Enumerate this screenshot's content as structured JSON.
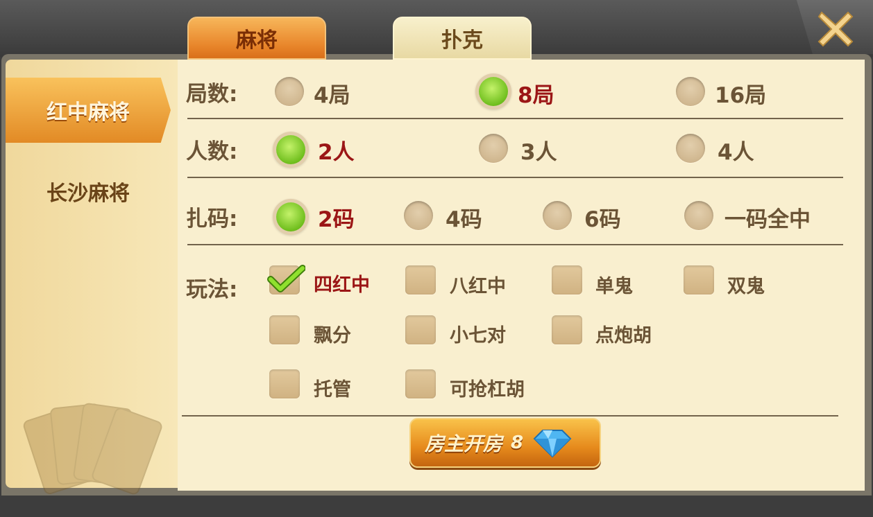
{
  "tabs": [
    {
      "label": "麻将",
      "active": true
    },
    {
      "label": "扑克",
      "active": false
    }
  ],
  "sidebar": {
    "items": [
      {
        "label": "红中麻将",
        "active": true
      },
      {
        "label": "长沙麻将",
        "active": false
      }
    ]
  },
  "rounds": {
    "label": "局数:",
    "options": [
      "4局",
      "8局",
      "16局"
    ],
    "selected": "8局"
  },
  "players": {
    "label": "人数:",
    "options": [
      "2人",
      "3人",
      "4人"
    ],
    "selected": "2人"
  },
  "zhama": {
    "label": "扎码:",
    "options": [
      "2码",
      "4码",
      "6码",
      "一码全中"
    ],
    "selected": "2码"
  },
  "rules": {
    "label": "玩法:",
    "options": [
      {
        "label": "四红中",
        "checked": true
      },
      {
        "label": "八红中",
        "checked": false
      },
      {
        "label": "单鬼",
        "checked": false
      },
      {
        "label": "双鬼",
        "checked": false
      },
      {
        "label": "飘分",
        "checked": false
      },
      {
        "label": "小七对",
        "checked": false
      },
      {
        "label": "点炮胡",
        "checked": false
      },
      {
        "label": "托管",
        "checked": false
      },
      {
        "label": "可抢杠胡",
        "checked": false
      }
    ]
  },
  "create_button": {
    "label": "房主开房",
    "cost": "8",
    "currency_icon": "diamond-icon"
  },
  "icons": {
    "close": "close-icon",
    "check": "checkmark-icon"
  },
  "colors": {
    "accent_orange": "#e8852a",
    "selected_text": "#9b1616",
    "radio_on": "#6fbe1d",
    "panel_bg": "#f9efcf"
  }
}
